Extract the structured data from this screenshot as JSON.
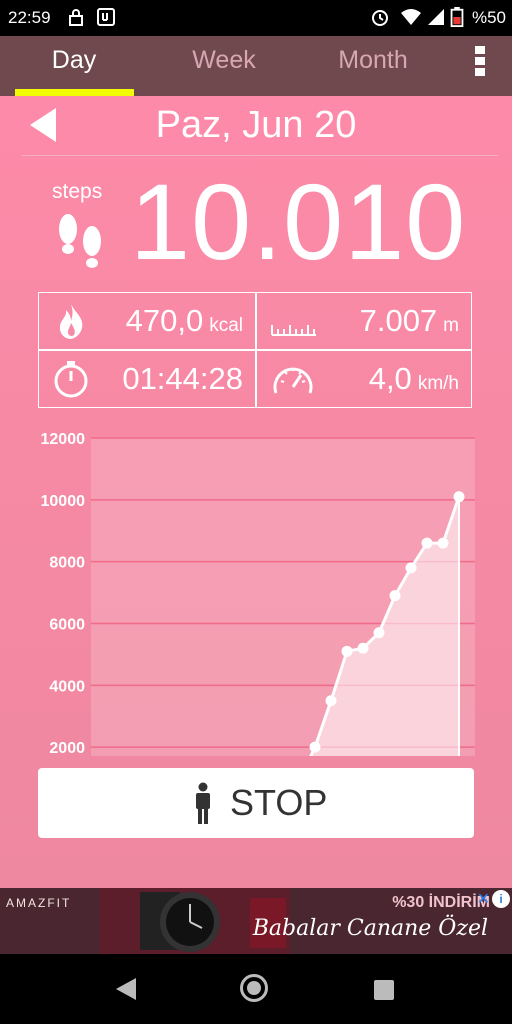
{
  "status_bar": {
    "time": "22:59",
    "battery": "%50"
  },
  "tabs": [
    {
      "label": "Day",
      "active": true
    },
    {
      "label": "Week",
      "active": false
    },
    {
      "label": "Month",
      "active": false
    }
  ],
  "date": "Paz, Jun 20",
  "steps": {
    "label": "steps",
    "value": "10.010"
  },
  "stats": {
    "calories": {
      "value": "470,0",
      "unit": "kcal"
    },
    "distance": {
      "value": "7.007",
      "unit": "m"
    },
    "duration": {
      "value": "01:44:28"
    },
    "speed": {
      "value": "4,0",
      "unit": "km/h"
    }
  },
  "chart_data": {
    "type": "area",
    "x": [
      0,
      1,
      2,
      3,
      4,
      5,
      6,
      7,
      8,
      9,
      10,
      11,
      12,
      13,
      14,
      15,
      16,
      17,
      18,
      19,
      20,
      21,
      22,
      23
    ],
    "values": [
      0,
      0,
      0,
      0,
      0,
      0,
      0,
      0,
      0,
      0,
      0,
      0,
      0,
      900,
      2000,
      3500,
      5100,
      5200,
      5700,
      6900,
      7800,
      8600,
      8600,
      10100
    ],
    "x_ticks": [
      "2",
      "4",
      "6",
      "8",
      "10",
      "12",
      "14",
      "16",
      "18",
      "20",
      "22",
      "24"
    ],
    "y_ticks": [
      "2000",
      "4000",
      "6000",
      "8000",
      "10000",
      "12000"
    ],
    "ylim": [
      0,
      12000
    ],
    "xlim": [
      0,
      24
    ],
    "grid": true
  },
  "stop_button": {
    "label": "STOP"
  },
  "ad": {
    "brand": "AMAZFIT",
    "promo": "%30 İNDİRİM",
    "slogan": "Babalar Canane Özel"
  },
  "colors": {
    "tab_bar": "#70494f",
    "accent": "#f1fb05",
    "background": "#fd8aa8"
  }
}
